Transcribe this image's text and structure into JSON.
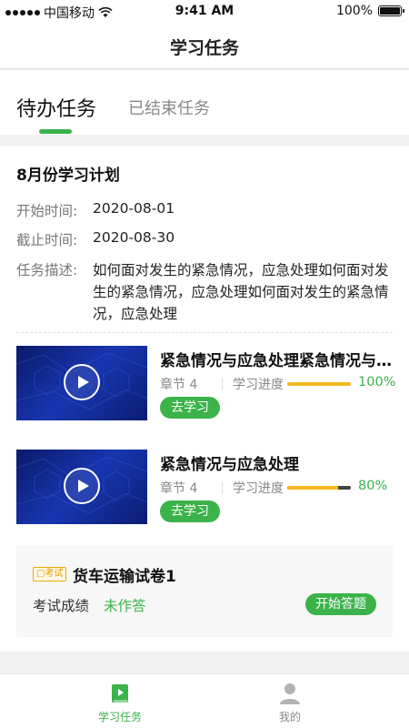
{
  "status_bar": {
    "carrier": "中国移动",
    "time": "9:41 AM",
    "battery": "100%"
  },
  "nav": {
    "title": "学习任务"
  },
  "tabs": [
    {
      "label": "待办任务",
      "active": true
    },
    {
      "label": "已结束任务",
      "active": false
    }
  ],
  "plan": {
    "title": "8月份学习计划",
    "start_label": "开始时间:",
    "start_value": "2020-08-01",
    "end_label": "截止时间:",
    "end_value": "2020-08-30",
    "desc_label": "任务描述:",
    "desc_value": "如何面对发生的紧急情况，应急处理如何面对发生的紧急情况，应急处理如何面对发生的紧急情况，应急处理"
  },
  "courses": [
    {
      "title": "紧急情况与应急处理紧急情况与应急处理",
      "chapter": "章节 4",
      "progress_label": "学习进度",
      "progress_pct": "100%",
      "progress": 1.0,
      "button": "去学习"
    },
    {
      "title": "紧急情况与应急处理",
      "chapter": "章节 4",
      "progress_label": "学习进度",
      "progress_pct": "80%",
      "progress": 0.8,
      "button": "去学习"
    }
  ],
  "exam": {
    "badge": "考试",
    "title": "货车运输试卷1",
    "score_label": "考试成绩",
    "score_value": "未作答",
    "button": "开始答题"
  },
  "bottom_nav": [
    {
      "label": "学习任务",
      "icon": "play-book-icon",
      "active": true
    },
    {
      "label": "我的",
      "icon": "user-icon",
      "active": false
    }
  ],
  "colors": {
    "accent": "#3bb34a",
    "progress": "#f5b921",
    "badge": "#f0a800"
  }
}
